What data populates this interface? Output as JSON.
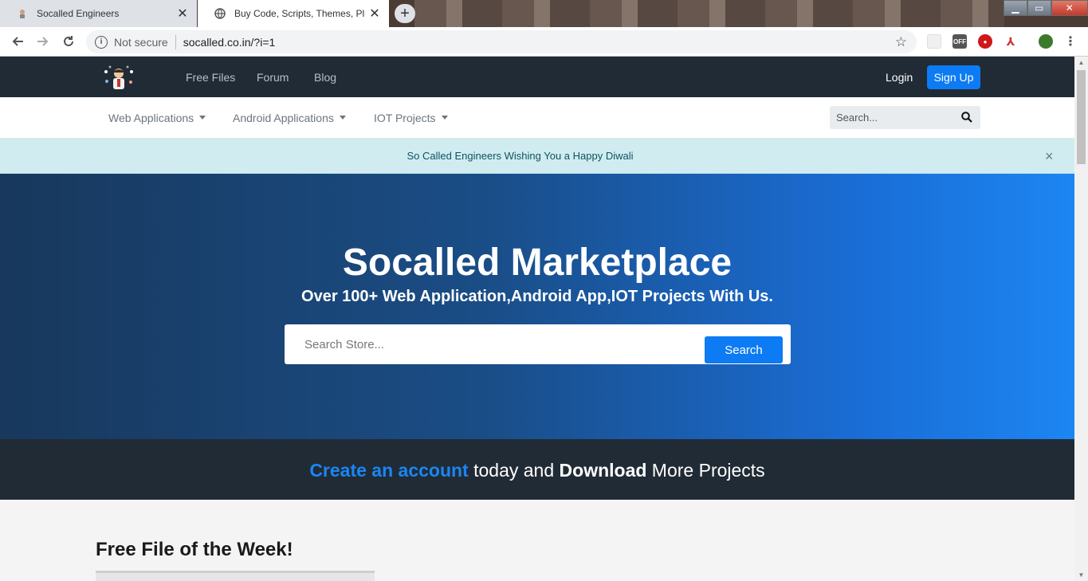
{
  "browser": {
    "tabs": [
      {
        "title": "Socalled Engineers",
        "active": false
      },
      {
        "title": "Buy Code, Scripts, Themes, Plugi",
        "active": true
      }
    ],
    "new_tab": "+",
    "close": "✕",
    "security": "Not secure",
    "url": "socalled.co.in/?i=1",
    "extension_off": "OFF"
  },
  "topnav": {
    "links": [
      "Free Files",
      "Forum",
      "Blog"
    ],
    "login": "Login",
    "signup": "Sign Up"
  },
  "subnav": {
    "menus": [
      "Web Applications",
      "Android Applications",
      "IOT Projects"
    ],
    "search_placeholder": "Search..."
  },
  "alert": {
    "message": "So Called Engineers Wishing You a Happy Diwali",
    "close": "×"
  },
  "hero": {
    "title": "Socalled Marketplace",
    "subtitle": "Over 100+ Web Application,Android App,IOT Projects With Us.",
    "search_placeholder": "Search Store...",
    "search_button": "Search"
  },
  "cta": {
    "link": "Create an account",
    "middle": " today and ",
    "bold": "Download",
    "end": " More Projects"
  },
  "section": {
    "title": "Free File of the Week!"
  },
  "colors": {
    "nav_bg": "#212b35",
    "primary": "#0d7bf3",
    "alert_bg": "#d1ecf1",
    "alert_text": "#0c5460"
  }
}
